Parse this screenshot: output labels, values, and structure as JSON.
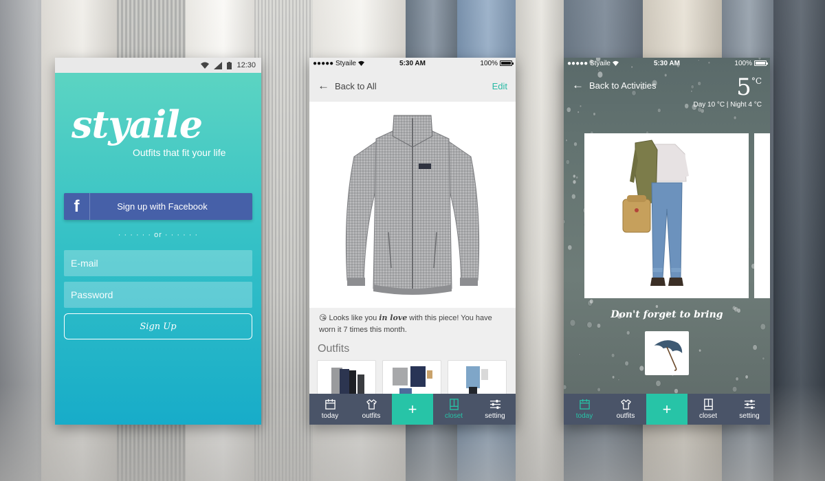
{
  "colors": {
    "accent": "#27c4a7",
    "facebook": "#4660a8",
    "tabbar": "#4a5468",
    "teal_gradient_top": "#5fd6c2",
    "teal_gradient_bottom": "#17acc9"
  },
  "signup_screen": {
    "status_time": "12:30",
    "logo": "styaile",
    "tagline": "Outfits that fit your life",
    "facebook_icon": "f",
    "facebook_label": "Sign up with Facebook",
    "divider": "· · · · · ·   or   · · · · · ·",
    "email_placeholder": "E-mail",
    "password_placeholder": "Password",
    "signup_label": "Sign Up"
  },
  "item_screen": {
    "status": {
      "carrier": "●●●●● Styaile",
      "time": "5:30 AM",
      "battery": "100%"
    },
    "back_label": "Back to All",
    "edit_label": "Edit",
    "note_emoji": "😘",
    "note_before": " Looks like you ",
    "note_emphasis": "in love",
    "note_after": " with this piece! You have worn it 7 times this month.",
    "outfits_title": "Outfits"
  },
  "today_screen": {
    "status": {
      "carrier": "●●●●● Styaile",
      "time": "5:30 AM",
      "battery": "100%"
    },
    "back_label": "Back to Activities",
    "temperature": "5",
    "temperature_unit": "°C",
    "day_night": "Day 10 °C | Night 4 °C",
    "reminder": "Don't forget to bring"
  },
  "tabs": [
    {
      "label": "today",
      "icon": "calendar-icon"
    },
    {
      "label": "outfits",
      "icon": "shirt-icon"
    },
    {
      "label": "+",
      "icon": "plus-icon"
    },
    {
      "label": "closet",
      "icon": "closet-icon"
    },
    {
      "label": "setting",
      "icon": "sliders-icon"
    }
  ]
}
